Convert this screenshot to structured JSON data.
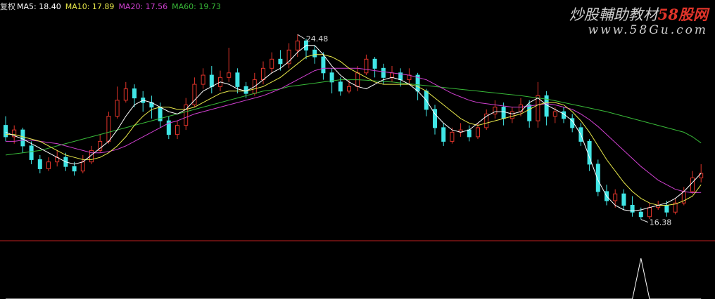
{
  "legend": {
    "prefix": "复权",
    "ma5": "MA5: 18.40",
    "ma10": "MA10: 17.89",
    "ma20": "MA20: 17.56",
    "ma60": "MA60: 19.73"
  },
  "watermark": {
    "cn_prefix": "炒股輔助教材",
    "cn_brand": "58股网",
    "url": "www.58Gu.com"
  },
  "colors": {
    "background": "#000000",
    "up": "#e0342a",
    "down": "#40e6e6",
    "ma5": "#ffffff",
    "ma10": "#e8e84a",
    "ma20": "#d040d0",
    "ma60": "#38b838",
    "divider": "#c02020"
  },
  "chart_data": [
    {
      "type": "candlestick",
      "title": "",
      "price_range": [
        15.6,
        25.5
      ],
      "annotations": [
        {
          "label": "24.48",
          "type": "period-high"
        },
        {
          "label": "16.38",
          "type": "period-low"
        }
      ],
      "ma": {
        "ma5": [
          20.2,
          20.05,
          19.9,
          19.7,
          19.5,
          19.3,
          19.1,
          18.9,
          18.8,
          18.9,
          19.2,
          19.5,
          19.8,
          20.3,
          20.9,
          21.4,
          21.6,
          21.5,
          21.3,
          21.1,
          21.0,
          21.2,
          21.6,
          22.0,
          22.2,
          22.4,
          22.3,
          22.1,
          22.0,
          22.2,
          22.5,
          22.8,
          23.0,
          23.3,
          23.7,
          24.0,
          24.0,
          23.6,
          23.1,
          22.7,
          22.4,
          22.2,
          22.1,
          22.3,
          22.5,
          22.6,
          22.5,
          22.3,
          22.0,
          21.6,
          21.0,
          20.6,
          20.3,
          20.2,
          20.3,
          20.6,
          20.9,
          21.1,
          21.1,
          21.0,
          21.1,
          21.5,
          21.7,
          21.4,
          21.2,
          21.0,
          20.7,
          20.1,
          19.1,
          18.1,
          17.4,
          17.0,
          16.8,
          16.75,
          16.8,
          16.9,
          17.0,
          17.1,
          17.3,
          17.6,
          18.0,
          18.4
        ],
        "ma10": [
          20.1,
          20.1,
          20.0,
          19.9,
          19.8,
          19.6,
          19.4,
          19.2,
          19.1,
          19.0,
          19.0,
          19.1,
          19.3,
          19.6,
          20.0,
          20.5,
          20.9,
          21.2,
          21.3,
          21.3,
          21.2,
          21.2,
          21.3,
          21.5,
          21.7,
          21.9,
          22.0,
          22.0,
          22.0,
          22.1,
          22.2,
          22.4,
          22.6,
          22.9,
          23.2,
          23.5,
          23.6,
          23.6,
          23.5,
          23.3,
          23.0,
          22.8,
          22.6,
          22.4,
          22.3,
          22.3,
          22.3,
          22.3,
          22.2,
          22.0,
          21.7,
          21.4,
          21.1,
          20.8,
          20.6,
          20.5,
          20.6,
          20.7,
          20.8,
          20.9,
          21.0,
          21.2,
          21.4,
          21.5,
          21.5,
          21.4,
          21.1,
          20.7,
          20.2,
          19.6,
          19.0,
          18.5,
          18.0,
          17.6,
          17.3,
          17.1,
          17.0,
          17.0,
          17.05,
          17.2,
          17.4,
          17.9
        ],
        "ma20": [
          19.8,
          19.8,
          19.85,
          19.85,
          19.8,
          19.75,
          19.7,
          19.6,
          19.5,
          19.4,
          19.3,
          19.3,
          19.35,
          19.45,
          19.6,
          19.8,
          20.0,
          20.2,
          20.4,
          20.6,
          20.7,
          20.85,
          21.0,
          21.1,
          21.2,
          21.3,
          21.4,
          21.5,
          21.6,
          21.7,
          21.8,
          21.95,
          22.1,
          22.3,
          22.5,
          22.7,
          22.9,
          23.0,
          23.0,
          23.0,
          23.0,
          23.0,
          22.95,
          22.9,
          22.85,
          22.8,
          22.75,
          22.7,
          22.6,
          22.5,
          22.3,
          22.1,
          21.9,
          21.75,
          21.6,
          21.5,
          21.45,
          21.4,
          21.35,
          21.3,
          21.3,
          21.35,
          21.4,
          21.45,
          21.4,
          21.3,
          21.2,
          21.0,
          20.75,
          20.45,
          20.1,
          19.75,
          19.4,
          19.05,
          18.7,
          18.4,
          18.1,
          17.9,
          17.7,
          17.6,
          17.55,
          17.56
        ]
      },
      "ma60": [
        19.2,
        19.25,
        19.3,
        19.35,
        19.4,
        19.5,
        19.6,
        19.7,
        19.8,
        19.9,
        20.0,
        20.1,
        20.2,
        20.3,
        20.4,
        20.5,
        20.6,
        20.7,
        20.8,
        20.9,
        21.0,
        21.1,
        21.2,
        21.3,
        21.4,
        21.5,
        21.6,
        21.7,
        21.8,
        21.9,
        22.0,
        22.05,
        22.1,
        22.2,
        22.25,
        22.3,
        22.35,
        22.4,
        22.45,
        22.5,
        22.5,
        22.5,
        22.48,
        22.45,
        22.42,
        22.4,
        22.36,
        22.32,
        22.28,
        22.24,
        22.2,
        22.16,
        22.12,
        22.08,
        22.04,
        22.0,
        21.96,
        21.92,
        21.88,
        21.84,
        21.8,
        21.75,
        21.7,
        21.65,
        21.58,
        21.5,
        21.42,
        21.34,
        21.26,
        21.18,
        21.1,
        21.0,
        20.9,
        20.8,
        20.7,
        20.6,
        20.5,
        20.4,
        20.3,
        20.2,
        20.0,
        19.73
      ],
      "candles": [
        [
          20.5,
          20.0,
          20.9,
          19.8
        ],
        [
          20.0,
          20.3,
          20.5,
          19.7
        ],
        [
          20.3,
          19.6,
          20.4,
          19.3
        ],
        [
          19.6,
          19.0,
          19.8,
          18.8
        ],
        [
          19.0,
          18.6,
          19.2,
          18.4
        ],
        [
          18.6,
          18.9,
          19.1,
          18.5
        ],
        [
          18.9,
          19.1,
          19.4,
          18.7
        ],
        [
          19.1,
          18.7,
          19.3,
          18.5
        ],
        [
          18.7,
          18.5,
          18.9,
          18.3
        ],
        [
          18.5,
          18.9,
          19.2,
          18.4
        ],
        [
          18.9,
          19.4,
          19.6,
          18.8
        ],
        [
          19.4,
          19.8,
          20.1,
          19.3
        ],
        [
          19.8,
          20.9,
          21.1,
          19.7
        ],
        [
          20.9,
          21.6,
          22.2,
          20.8
        ],
        [
          21.6,
          22.1,
          22.4,
          21.5
        ],
        [
          22.1,
          21.7,
          22.3,
          21.3
        ],
        [
          21.7,
          21.5,
          22.0,
          21.1
        ],
        [
          21.5,
          21.3,
          21.8,
          20.8
        ],
        [
          21.3,
          20.7,
          21.5,
          20.4
        ],
        [
          20.7,
          20.1,
          20.9,
          19.9
        ],
        [
          20.1,
          20.5,
          20.7,
          19.9
        ],
        [
          20.5,
          21.4,
          21.7,
          20.3
        ],
        [
          21.4,
          22.3,
          22.6,
          21.3
        ],
        [
          22.3,
          22.7,
          23.0,
          22.1
        ],
        [
          22.7,
          22.2,
          23.1,
          21.9
        ],
        [
          22.2,
          22.6,
          22.9,
          22.0
        ],
        [
          22.6,
          22.8,
          23.9,
          22.4
        ],
        [
          22.8,
          22.2,
          23.0,
          21.9
        ],
        [
          22.2,
          21.9,
          22.4,
          21.7
        ],
        [
          21.9,
          22.5,
          22.8,
          21.8
        ],
        [
          22.5,
          23.0,
          23.3,
          22.3
        ],
        [
          23.0,
          23.4,
          23.7,
          22.8
        ],
        [
          23.4,
          23.2,
          23.8,
          22.9
        ],
        [
          23.2,
          23.8,
          24.1,
          23.0
        ],
        [
          23.8,
          24.2,
          24.48,
          23.5
        ],
        [
          24.2,
          23.8,
          24.3,
          23.4
        ],
        [
          23.8,
          23.5,
          24.0,
          23.2
        ],
        [
          23.5,
          22.8,
          23.7,
          22.5
        ],
        [
          22.8,
          22.4,
          23.0,
          21.9
        ],
        [
          22.4,
          22.0,
          22.6,
          21.8
        ],
        [
          22.0,
          22.2,
          22.5,
          21.9
        ],
        [
          22.2,
          22.8,
          23.1,
          22.0
        ],
        [
          22.8,
          23.4,
          23.6,
          22.7
        ],
        [
          23.4,
          23.0,
          23.5,
          22.6
        ],
        [
          23.0,
          22.6,
          23.2,
          22.3
        ],
        [
          22.6,
          22.8,
          23.1,
          22.4
        ],
        [
          22.8,
          22.5,
          23.0,
          22.2
        ],
        [
          22.5,
          22.7,
          23.0,
          22.3
        ],
        [
          22.7,
          22.0,
          22.8,
          21.6
        ],
        [
          22.0,
          21.2,
          22.1,
          20.9
        ],
        [
          21.2,
          20.4,
          21.4,
          20.1
        ],
        [
          20.4,
          19.8,
          20.6,
          19.6
        ],
        [
          19.8,
          20.2,
          20.4,
          19.7
        ],
        [
          20.2,
          20.3,
          20.6,
          20.0
        ],
        [
          20.3,
          20.0,
          20.5,
          19.8
        ],
        [
          20.0,
          20.4,
          20.6,
          19.9
        ],
        [
          20.4,
          21.0,
          21.2,
          20.3
        ],
        [
          21.0,
          21.3,
          21.6,
          20.8
        ],
        [
          21.3,
          20.8,
          21.5,
          20.5
        ],
        [
          20.8,
          21.1,
          21.3,
          20.6
        ],
        [
          21.1,
          21.4,
          21.7,
          20.9
        ],
        [
          21.4,
          20.7,
          21.6,
          20.4
        ],
        [
          20.7,
          21.8,
          22.4,
          20.4
        ],
        [
          21.8,
          20.9,
          22.0,
          20.5
        ],
        [
          20.9,
          21.1,
          21.3,
          20.6
        ],
        [
          21.1,
          20.8,
          21.3,
          20.6
        ],
        [
          20.8,
          20.4,
          21.0,
          20.2
        ],
        [
          20.4,
          19.8,
          20.6,
          19.6
        ],
        [
          19.8,
          18.8,
          19.9,
          18.5
        ],
        [
          18.8,
          17.6,
          19.0,
          17.4
        ],
        [
          17.6,
          17.2,
          17.9,
          17.0
        ],
        [
          17.2,
          17.5,
          17.7,
          16.9
        ],
        [
          17.5,
          17.0,
          17.7,
          16.8
        ],
        [
          17.0,
          16.7,
          17.4,
          16.5
        ],
        [
          16.7,
          16.5,
          16.9,
          16.38
        ],
        [
          16.5,
          16.9,
          17.1,
          16.4
        ],
        [
          16.9,
          17.0,
          17.2,
          16.8
        ],
        [
          17.0,
          16.7,
          17.2,
          16.5
        ],
        [
          16.7,
          17.1,
          17.3,
          16.6
        ],
        [
          17.1,
          17.6,
          17.8,
          17.0
        ],
        [
          17.6,
          18.2,
          18.5,
          17.5
        ],
        [
          18.2,
          18.4,
          18.8,
          18.0
        ]
      ]
    },
    {
      "type": "line",
      "title": "",
      "values": [
        0,
        0,
        0,
        0,
        0,
        0,
        0,
        0,
        0,
        0,
        0,
        0,
        0,
        0,
        0,
        0,
        0,
        0,
        0,
        0,
        0,
        0,
        0,
        0,
        0,
        0,
        0,
        0,
        0,
        0,
        0,
        0,
        0,
        0,
        0,
        0,
        0,
        0,
        0,
        0,
        0,
        0,
        0,
        0,
        0,
        0,
        0,
        0,
        0,
        0,
        0,
        0,
        0,
        0,
        0,
        0,
        0,
        0,
        0,
        0,
        0,
        0,
        0,
        0,
        0,
        0,
        0,
        0,
        0,
        0,
        0,
        0,
        0,
        0,
        1,
        0,
        0,
        0,
        0,
        0,
        0,
        0
      ],
      "ylim": [
        0,
        1
      ]
    }
  ]
}
